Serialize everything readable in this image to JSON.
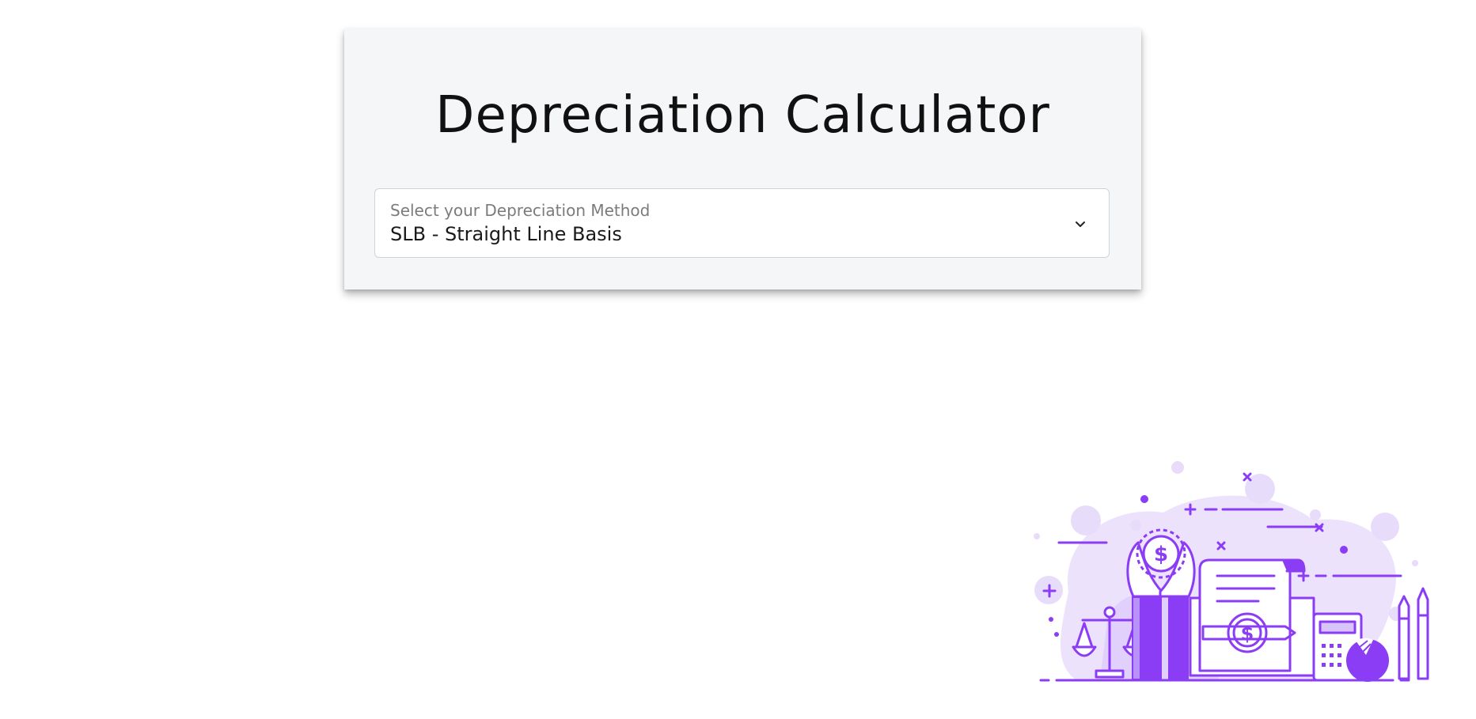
{
  "page": {
    "title": "Depreciation Calculator"
  },
  "method_select": {
    "label": "Select your Depreciation Method",
    "selected_value": "SLB - Straight Line Basis",
    "icon": "chevron-down-icon"
  },
  "illustration": {
    "name": "finance-illustration",
    "accent_color": "#8b3cf5",
    "light_color": "#ece2fc"
  },
  "colors": {
    "card_background": "#f5f6f7",
    "page_background": "#ffffff",
    "title_text": "#111111"
  }
}
